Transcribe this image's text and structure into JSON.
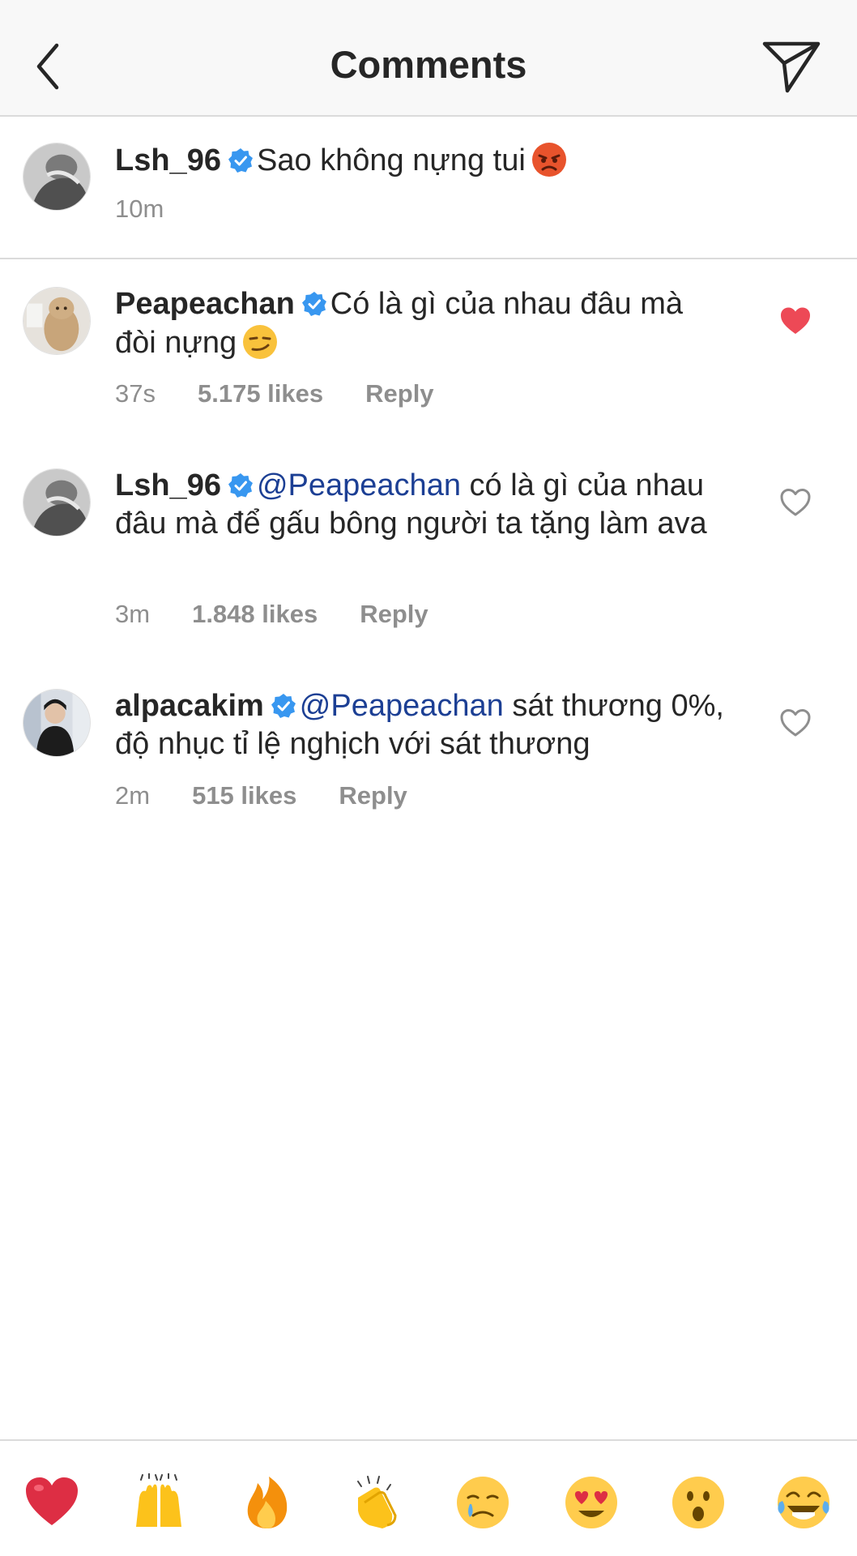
{
  "header": {
    "title": "Comments",
    "back_icon": "chevron-left-icon",
    "share_icon": "paper-plane-icon"
  },
  "caption": {
    "username": "Lsh_96",
    "text": "Sao không nựng tui",
    "emoji": "angry-face",
    "time": "10m"
  },
  "comments": [
    {
      "username": "Peapeachan",
      "text": "Có là gì của nhau đâu mà đòi nựng",
      "emoji": "smirking-face",
      "time": "37s",
      "likes": "5.175 likes",
      "reply": "Reply",
      "liked": true
    },
    {
      "username": "Lsh_96",
      "mention": "@Peapeachan",
      "text": "có là gì của nhau đâu mà để gấu bông người ta tặng làm ava",
      "time": "3m",
      "likes": "1.848 likes",
      "reply": "Reply",
      "liked": false
    },
    {
      "username": "alpacakim",
      "mention": "@Peapeachan",
      "text": "sát thương 0%, độ nhục tỉ lệ nghịch với sát thương",
      "time": "2m",
      "likes": "515 likes",
      "reply": "Reply",
      "liked": false
    }
  ],
  "emoji_bar": [
    "red-heart",
    "raising-hands",
    "fire",
    "clapping-hands",
    "crying-face",
    "heart-eyes",
    "surprised-face",
    "tears-of-joy"
  ],
  "colors": {
    "like_red": "#ed4956",
    "mention_blue": "#1c3f94",
    "verified_blue": "#3897f0",
    "meta_gray": "#8e8e8e"
  }
}
